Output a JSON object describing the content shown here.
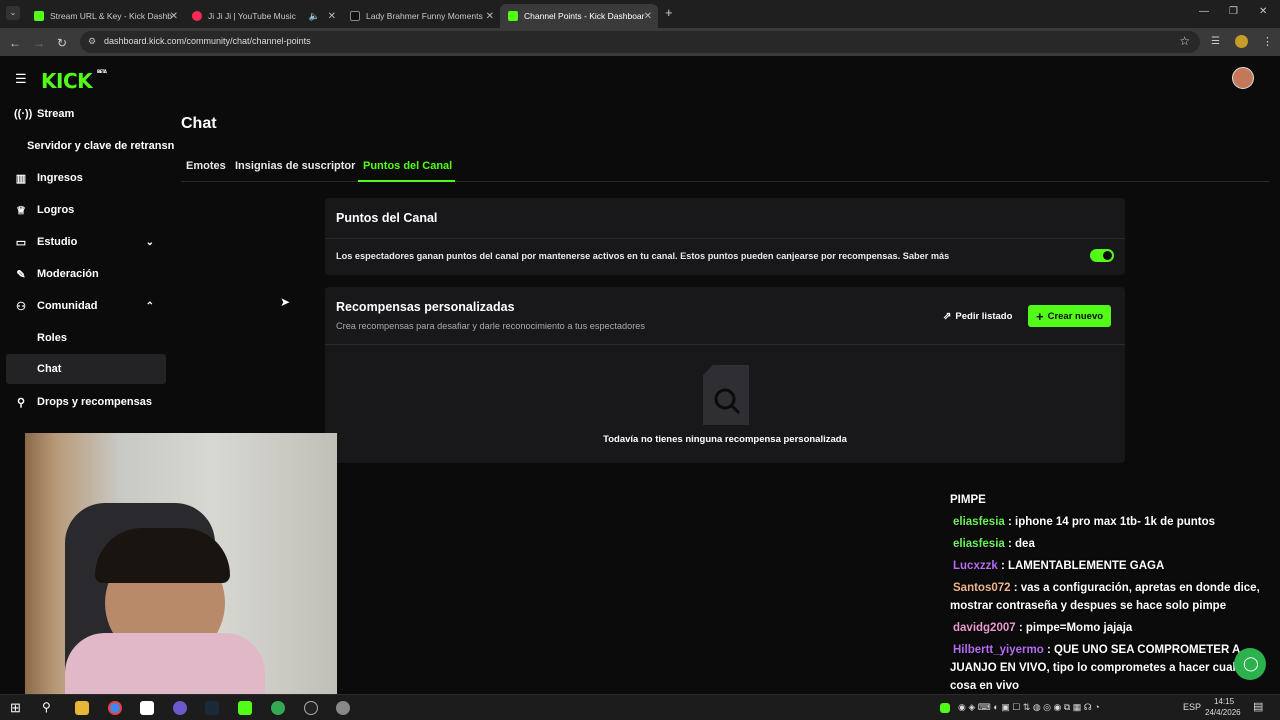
{
  "browser": {
    "tabs": [
      {
        "title": "Stream URL & Key - Kick Dashb",
        "active": false
      },
      {
        "title": "Ji Ji Ji | YouTube Music",
        "active": false
      },
      {
        "title": "Lady Brahmer Funny Moments",
        "active": false
      },
      {
        "title": "Channel Points - Kick Dashboar",
        "active": true
      }
    ],
    "url": "dashboard.kick.com/community/chat/channel-points"
  },
  "brand": {
    "logo": "KICK",
    "badge": "BETA",
    "accent": "#53fc18"
  },
  "sidebar": {
    "items": [
      {
        "label": "Stream",
        "icon": "broadcast-icon"
      },
      {
        "label": "Servidor y clave de retransn",
        "icon": ""
      },
      {
        "label": "Ingresos",
        "icon": "chart-icon"
      },
      {
        "label": "Logros",
        "icon": "trophy-icon"
      },
      {
        "label": "Estudio",
        "icon": "studio-icon"
      },
      {
        "label": "Moderación",
        "icon": "wrench-icon"
      },
      {
        "label": "Comunidad",
        "icon": "users-icon"
      },
      {
        "label": "Roles",
        "icon": ""
      },
      {
        "label": "Chat",
        "icon": ""
      },
      {
        "label": "Drops y recompensas",
        "icon": "gift-icon"
      }
    ]
  },
  "main": {
    "title": "Chat",
    "tabs": [
      "Emotes",
      "Insignias de suscriptor",
      "Puntos del Canal"
    ],
    "points_card": {
      "title": "Puntos del Canal",
      "description": "Los espectadores ganan puntos del canal por mantenerse activos en tu canal. Estos puntos pueden canjearse por recompensas. Saber más",
      "enabled": true
    },
    "rewards_card": {
      "title": "Recompensas personalizadas",
      "subtitle": "Crea recompensas para desafiar y darle reconocimiento a tus espectadores",
      "request_button": "Pedir listado",
      "create_button": "Crear nuevo",
      "empty_text": "Todavía no tienes ninguna recompensa personalizada"
    }
  },
  "chat_overlay": {
    "header": "PIMPE",
    "messages": [
      {
        "user": "eliasfesia",
        "color": "#6bf05a",
        "text": ": iphone 14 pro max 1tb- 1k de puntos"
      },
      {
        "user": "eliasfesia",
        "color": "#6bf05a",
        "text": ": dea"
      },
      {
        "user": "Lucxzzk",
        "color": "#b46cf0",
        "text": ": LAMENTABLEMENTE GAGA"
      },
      {
        "user": "Santos072",
        "color": "#f0b48c",
        "text": ": vas a configuración, apretas en donde dice, mostrar contraseña y despues se hace solo pimpe"
      },
      {
        "user": "davidg2007",
        "color": "#e89ad0",
        "text": ": pimpe=Momo jajaja"
      },
      {
        "user": "Hilbertt_yiyermo",
        "color": "#b46cf0",
        "text": ": QUE UNO SEA COMPROMETER A JUANJO EN VIVO, tipo lo comprometes a hacer cualquier cosa en vivo"
      }
    ]
  },
  "taskbar": {
    "lang": "ESP",
    "time": "14:15",
    "date": "24/4/2026"
  }
}
